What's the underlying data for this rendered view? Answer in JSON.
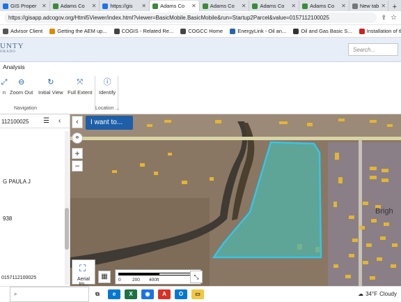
{
  "browser": {
    "tabs": [
      {
        "label": "GIS Proper",
        "color": "#1a73e8",
        "active": false
      },
      {
        "label": "Adams Co",
        "color": "#3a8a3a",
        "active": false
      },
      {
        "label": "https://gis",
        "color": "#1a73e8",
        "active": false
      },
      {
        "label": "Adams Co",
        "color": "#3a8a3a",
        "active": true
      },
      {
        "label": "Adams Co",
        "color": "#3a8a3a",
        "active": false
      },
      {
        "label": "Adams Co",
        "color": "#3a8a3a",
        "active": false
      },
      {
        "label": "Adams Co",
        "color": "#3a8a3a",
        "active": false
      },
      {
        "label": "New tab",
        "color": "#777777",
        "active": false
      }
    ],
    "url": "https://gisapp.adcogov.org/Html5Viewer/index.html?viewer=BasicMobile.BasicMobile&run=Startup2Parcel&value=0157112100025",
    "bookmarks": [
      {
        "label": "Advisor Client",
        "color": "#555555"
      },
      {
        "label": "Getting the AEM up...",
        "color": "#e08a00"
      },
      {
        "label": "COGIS - Related Re...",
        "color": "#444444"
      },
      {
        "label": "COGCC Home",
        "color": "#444444"
      },
      {
        "label": "EnergyLink - Oil an...",
        "color": "#2266aa"
      },
      {
        "label": "Oil and Gas Basic S...",
        "color": "#333333"
      },
      {
        "label": "Installation of the L...",
        "color": "#cc2222"
      }
    ]
  },
  "app": {
    "logo_main": "UNTY",
    "logo_sub": "ORADO",
    "search_placeholder": "Search...",
    "ribbon_tab": "Analysis",
    "buttons": [
      {
        "label": "n",
        "icon": "⤢"
      },
      {
        "label": "Zoom Out",
        "icon": "⊖"
      },
      {
        "label": "Initial View",
        "icon": "↻"
      },
      {
        "label": "Full Extent",
        "icon": "⤧"
      },
      {
        "label": "Identify",
        "icon": "ⓘ"
      }
    ],
    "group_navigation": "Navigation",
    "group_location": "Location ..."
  },
  "left_panel": {
    "parcel_id": "112100025",
    "owner": "G PAULA J",
    "value_938": "938",
    "footer_id": "0157112100025"
  },
  "map": {
    "i_want_to": "I want to...",
    "basemap_label": "Aerial Im...",
    "scale_0": "0",
    "scale_200": "200",
    "scale_400": "400ft",
    "label_brigh": "Brigh",
    "parcel_color": "#35c6e8"
  },
  "taskbar": {
    "weather_temp": "34°F",
    "weather_desc": "Cloudy"
  }
}
